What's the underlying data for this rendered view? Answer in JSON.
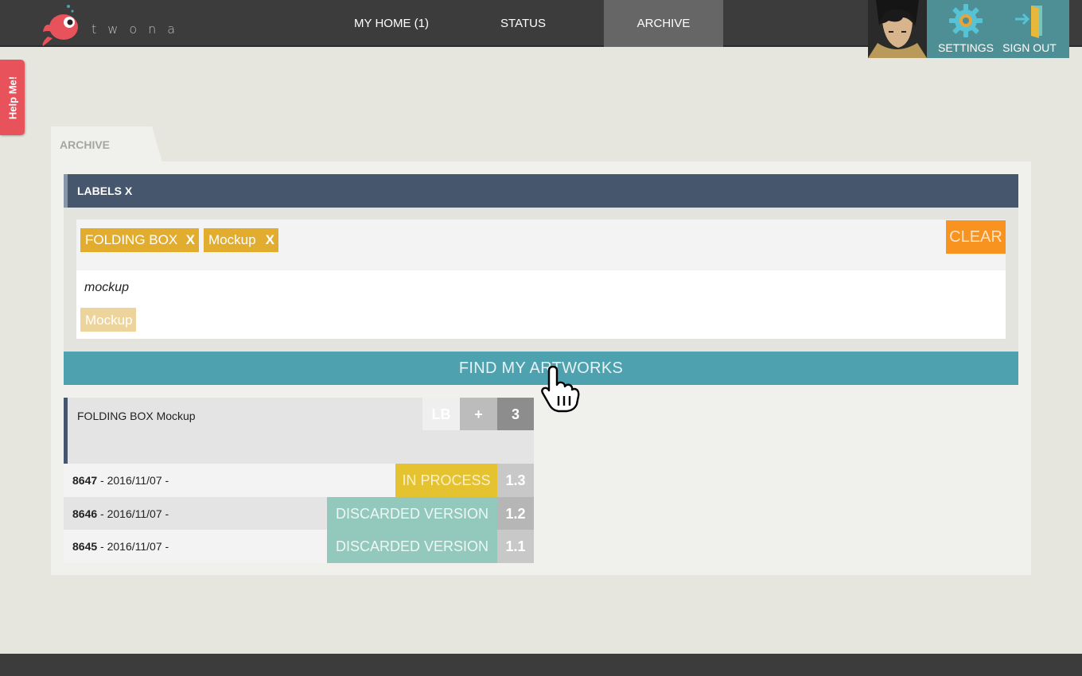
{
  "header": {
    "logo_text": "twona",
    "nav": [
      {
        "label": "MY HOME (1)"
      },
      {
        "label": "STATUS"
      },
      {
        "label": "ARCHIVE",
        "active": true
      }
    ],
    "settings_label": "SETTINGS",
    "signout_label": "SIGN OUT"
  },
  "help": {
    "label": "Help Me!"
  },
  "archive": {
    "tab_label": "ARCHIVE",
    "labels_header": "LABELS X",
    "selected_labels": [
      {
        "label": "FOLDING BOX",
        "remove": "X"
      },
      {
        "label": "Mockup",
        "remove": "X"
      }
    ],
    "clear_label": "CLEAR",
    "search_value": "mockup",
    "suggestions": [
      "Mockup"
    ],
    "find_label": "FIND MY ARTWORKS"
  },
  "results": {
    "title": "FOLDING BOX Mockup",
    "lb_label": "LB",
    "add_label": "+",
    "count": "3",
    "versions": [
      {
        "id": "8647",
        "date": " - 2016/11/07 -",
        "status": "IN PROCESS",
        "version": "1.3"
      },
      {
        "id": "8646",
        "date": " - 2016/11/07 -",
        "status": "DISCARDED VERSION",
        "version": "1.2"
      },
      {
        "id": "8645",
        "date": " - 2016/11/07 -",
        "status": "DISCARDED VERSION",
        "version": "1.1"
      }
    ]
  },
  "colors": {
    "accent_teal": "#4ea1ae",
    "header_navy": "#45566d",
    "tag_gold": "#e2ac2e",
    "clear_orange": "#f7931e",
    "status_in_process": "#e4c230",
    "status_discarded": "#93c9bc",
    "help_red": "#e8525b"
  }
}
